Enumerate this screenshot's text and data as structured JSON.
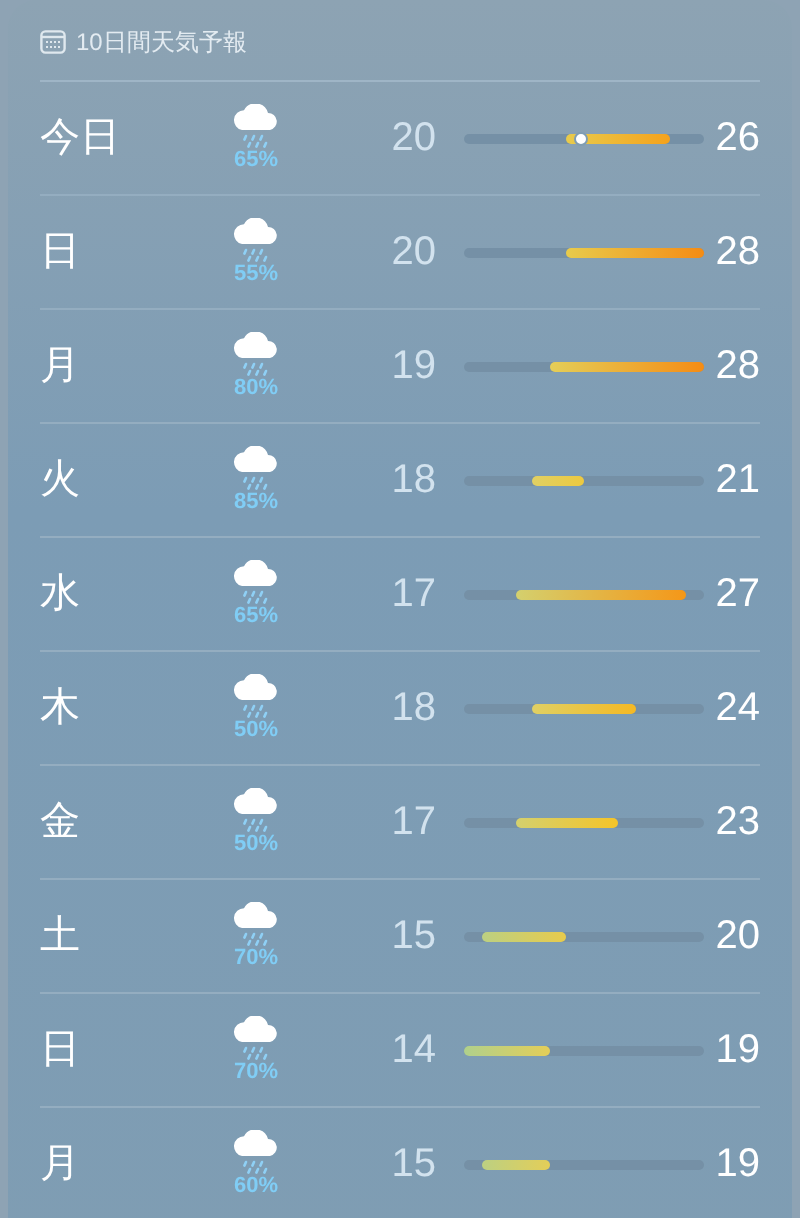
{
  "header": {
    "title": "10日間天気予報"
  },
  "days": [
    {
      "day": "今日",
      "precip": "65%",
      "low": "20",
      "high": "26",
      "level": 0.49
    },
    {
      "day": "日",
      "precip": "55%",
      "low": "20",
      "high": "28"
    },
    {
      "day": "月",
      "precip": "80%",
      "low": "19",
      "high": "28"
    },
    {
      "day": "火",
      "precip": "85%",
      "low": "18",
      "high": "21"
    },
    {
      "day": "水",
      "precip": "65%",
      "low": "17",
      "high": "27"
    },
    {
      "day": "木",
      "precip": "50%",
      "low": "18",
      "high": "24"
    },
    {
      "day": "金",
      "precip": "50%",
      "low": "17",
      "high": "23"
    },
    {
      "day": "土",
      "precip": "70%",
      "low": "15",
      "high": "20"
    },
    {
      "day": "日",
      "precip": "70%",
      "low": "14",
      "high": "19"
    },
    {
      "day": "月",
      "precip": "60%",
      "low": "15",
      "high": "19"
    }
  ]
}
